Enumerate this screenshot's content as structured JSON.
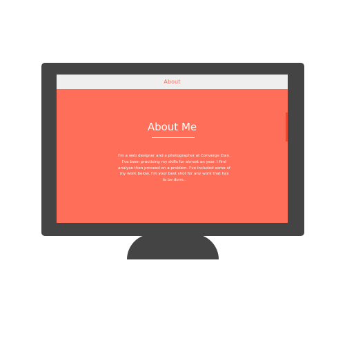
{
  "window": {
    "title": "About"
  },
  "about": {
    "heading": "About Me",
    "description": "I'm a web designer and a photographer at Converge Clan. I've been practising my skills for almost an year. I first analyse then proceed on a problem. I've included some of my work below. I'm your best shot for any work that has to be done.."
  },
  "colors": {
    "accent": "#ff6e58",
    "monitor": "#444444",
    "titlebar": "#efefef",
    "text": "#ffffff"
  }
}
